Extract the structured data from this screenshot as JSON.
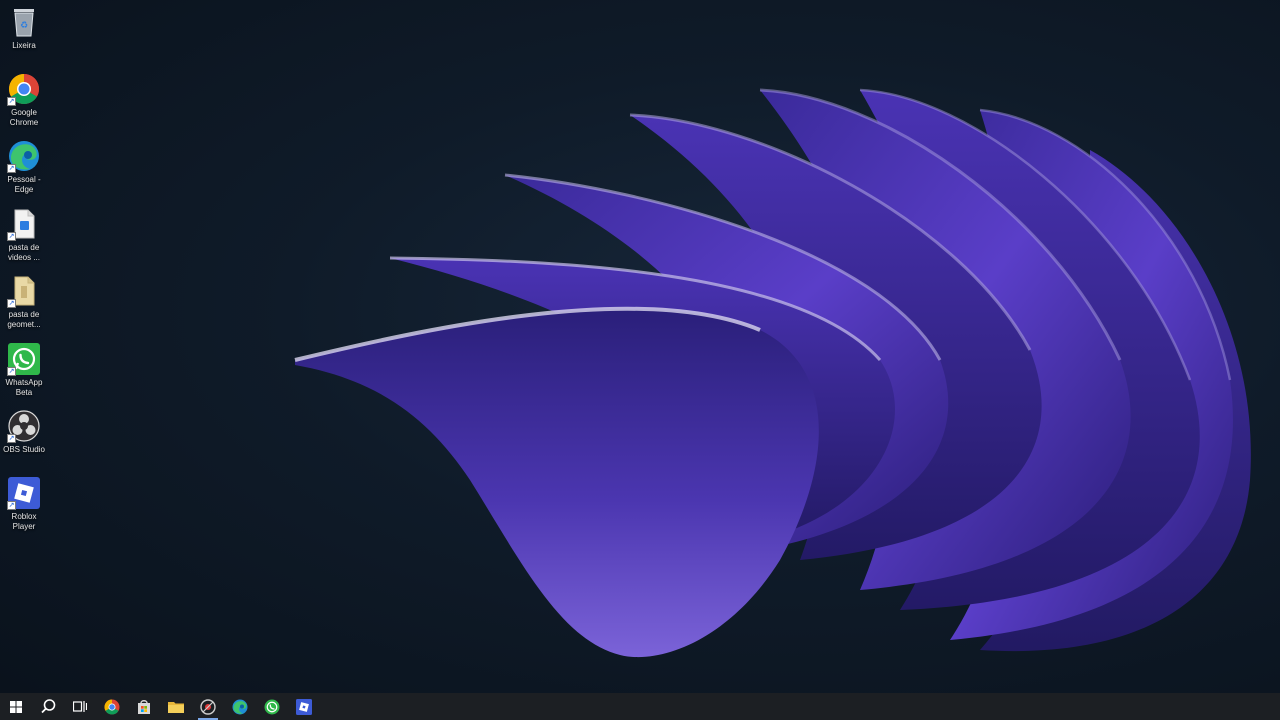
{
  "desktop": {
    "icons": [
      {
        "label": "Lixeira",
        "icon": "recycle-bin-icon"
      },
      {
        "label": "Google Chrome",
        "icon": "chrome-icon"
      },
      {
        "label": "Pessoal - Edge",
        "icon": "edge-icon"
      },
      {
        "label": "pasta de videos ...",
        "icon": "file-icon"
      },
      {
        "label": "pasta de geomet...",
        "icon": "folder-icon"
      },
      {
        "label": "WhatsApp Beta",
        "icon": "whatsapp-icon"
      },
      {
        "label": "OBS Studio",
        "icon": "obs-icon"
      },
      {
        "label": "Roblox Player",
        "icon": "roblox-icon"
      }
    ],
    "wallpaper": "windows-11-bloom-purple"
  },
  "taskbar": {
    "buttons": [
      {
        "icon": "windows-start-icon"
      },
      {
        "icon": "search-icon"
      },
      {
        "icon": "task-view-icon"
      },
      {
        "icon": "chrome-icon"
      },
      {
        "icon": "store-icon"
      },
      {
        "icon": "file-explorer-icon"
      },
      {
        "icon": "snipping-tool-icon"
      },
      {
        "icon": "edge-icon"
      },
      {
        "icon": "whatsapp-icon"
      },
      {
        "icon": "roblox-icon"
      }
    ]
  },
  "colors": {
    "taskbar_bg": "#1c1f23",
    "accent": "#7aa7e8",
    "bloom_purple": "#5b3fc4",
    "whatsapp_green": "#2fb84a",
    "roblox_blue": "#3d5bd6"
  }
}
